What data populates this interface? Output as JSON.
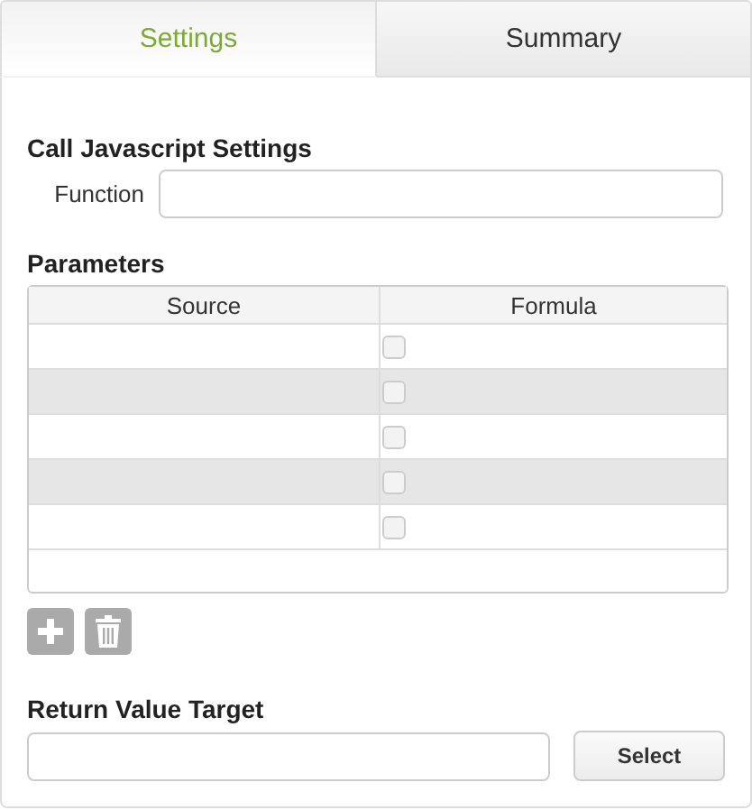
{
  "tabs": [
    {
      "label": "Settings",
      "selected": true
    },
    {
      "label": "Summary",
      "selected": false
    }
  ],
  "section_title": "Call Javascript Settings",
  "function_field": {
    "label": "Function"
  },
  "parameters": {
    "title": "Parameters",
    "columns": [
      "Source",
      "Formula"
    ],
    "rows": [
      {
        "formula_checked": false
      },
      {
        "formula_checked": false
      },
      {
        "formula_checked": false
      },
      {
        "formula_checked": false
      },
      {
        "formula_checked": false
      }
    ]
  },
  "return_value": {
    "title": "Return Value Target",
    "button": "Select"
  }
}
